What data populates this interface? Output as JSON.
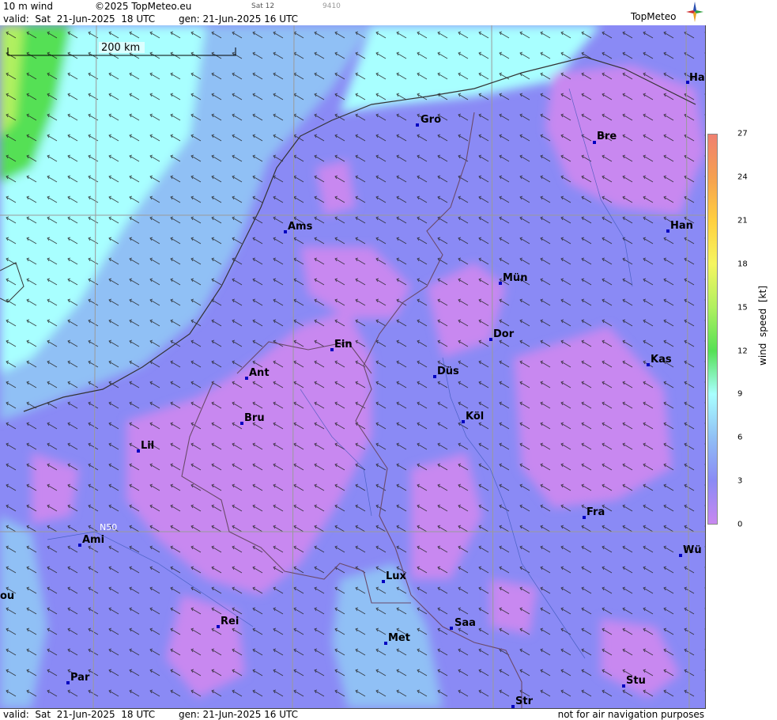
{
  "header": {
    "product": "10 m wind",
    "copyright": "©2025 TopMeteo.eu",
    "satellite": "Sat 12",
    "code": "9410",
    "valid": "valid:  Sat  21-Jun-2025  18 UTC",
    "generated": "gen: 21-Jun-2025 16 UTC",
    "brand": "TopMeteo"
  },
  "map": {
    "scale_label": "200 km",
    "lat_label": "N50",
    "cities": [
      {
        "name": "Ha"
      },
      {
        "name": "Gro"
      },
      {
        "name": "Bre"
      },
      {
        "name": "Ams"
      },
      {
        "name": "Han"
      },
      {
        "name": "Mün"
      },
      {
        "name": "Ein"
      },
      {
        "name": "Dor"
      },
      {
        "name": "Ant"
      },
      {
        "name": "Düs"
      },
      {
        "name": "Kas"
      },
      {
        "name": "Bru"
      },
      {
        "name": "Köl"
      },
      {
        "name": "Lil"
      },
      {
        "name": "Fra"
      },
      {
        "name": "Ami"
      },
      {
        "name": "Wü"
      },
      {
        "name": "Lux"
      },
      {
        "name": "ou"
      },
      {
        "name": "Rei"
      },
      {
        "name": "Saa"
      },
      {
        "name": "Met"
      },
      {
        "name": "Par"
      },
      {
        "name": "Stu"
      },
      {
        "name": "Str"
      }
    ]
  },
  "legend": {
    "title": "wind  speed  [kt]",
    "ticks": [
      "27",
      "24",
      "21",
      "18",
      "15",
      "12",
      "9",
      "6",
      "3",
      "0"
    ],
    "colors": [
      "#f08070",
      "#f5a050",
      "#ffd040",
      "#f5f560",
      "#b0f060",
      "#55e055",
      "#a8ffff",
      "#90c0f5",
      "#8a8af5",
      "#c888f0"
    ]
  },
  "footer": {
    "valid": "valid:  Sat  21-Jun-2025  18 UTC",
    "generated": "gen: 21-Jun-2025 16 UTC",
    "disclaimer": "not for air navigation purposes"
  }
}
